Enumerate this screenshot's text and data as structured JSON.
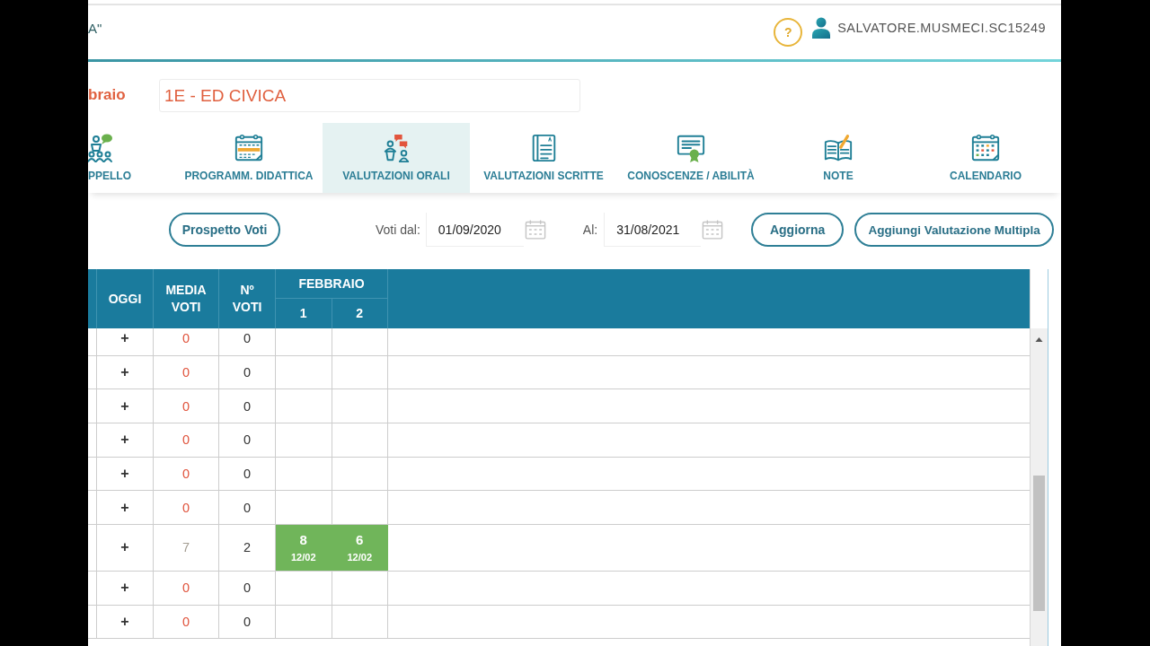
{
  "header": {
    "title_fragment": "A\"",
    "help_label": "?",
    "user_name": "SALVATORE.MUSMECI.SC15249"
  },
  "class_bar": {
    "label_fragment": "braio",
    "class_name": "1E - ED CIVICA"
  },
  "tabs": [
    {
      "label": "PPELLO",
      "kind": "attendance",
      "selected": false
    },
    {
      "label": "PROGRAMM. DIDATTICA",
      "kind": "planner",
      "selected": false
    },
    {
      "label": "VALUTAZIONI ORALI",
      "kind": "oral",
      "selected": true
    },
    {
      "label": "VALUTAZIONI SCRITTE",
      "kind": "written",
      "selected": false
    },
    {
      "label": "CONOSCENZE / ABILITÀ",
      "kind": "certificate",
      "selected": false
    },
    {
      "label": "NOTE",
      "kind": "notes",
      "selected": false
    },
    {
      "label": "CALENDARIO",
      "kind": "calendar",
      "selected": false
    }
  ],
  "toolbar": {
    "summary_button": "Prospetto Voti",
    "from_label": "Voti dal:",
    "from_date": "01/09/2020",
    "to_label": "Al:",
    "to_date": "31/08/2021",
    "buttons": [
      "Aggiorna",
      "Aggiungi Valutazione Multipla"
    ]
  },
  "table": {
    "columns": [
      "OGGI",
      "MEDIA VOTI",
      "Nº VOTI"
    ],
    "month": "FEBBRAIO",
    "days": [
      "1",
      "2"
    ],
    "rows": [
      {
        "today": "+",
        "average": {
          "value": "0",
          "color": "#e0533c"
        },
        "count": "0"
      },
      {
        "today": "+",
        "average": {
          "value": "0",
          "color": "#e0533c"
        },
        "count": "0"
      },
      {
        "today": "+",
        "average": {
          "value": "0",
          "color": "#e0533c"
        },
        "count": "0"
      },
      {
        "today": "+",
        "average": {
          "value": "0",
          "color": "#e0533c"
        },
        "count": "0"
      },
      {
        "today": "+",
        "average": {
          "value": "0",
          "color": "#e0533c"
        },
        "count": "0"
      },
      {
        "today": "+",
        "average": {
          "value": "0",
          "color": "#e0533c"
        },
        "count": "0"
      },
      {
        "today": "+",
        "average": {
          "value": "7",
          "color": "#a39d92"
        },
        "count": "2",
        "grades": [
          {
            "value": "8",
            "date": "12/02"
          },
          {
            "value": "6",
            "date": "12/02"
          }
        ]
      },
      {
        "today": "+",
        "average": {
          "value": "0",
          "color": "#e0533c"
        },
        "count": "0"
      },
      {
        "today": "+",
        "average": {
          "value": "0",
          "color": "#e0533c"
        },
        "count": "0"
      }
    ]
  }
}
